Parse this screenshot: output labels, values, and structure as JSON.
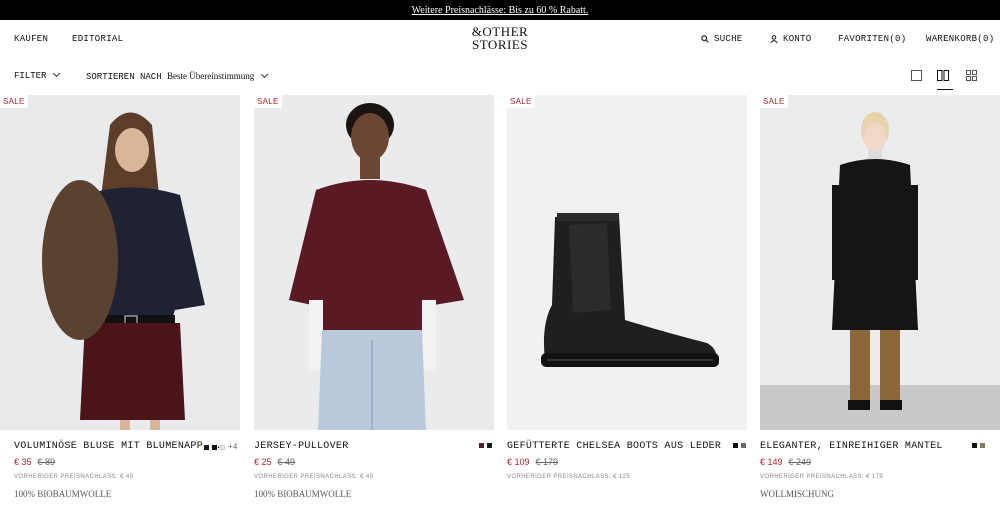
{
  "promo": {
    "text": "Weitere Preisnachlässe: Bis zu 60 % Rabatt."
  },
  "header": {
    "left_nav": [
      "KAUFEN",
      "EDITORIAL"
    ],
    "logo": {
      "line1": "&OTHER",
      "line2": "STORIES"
    },
    "search": "SUCHE",
    "account": "KONTO",
    "favorites": "FAVORITEN(0)",
    "cart": "WARENKORB(0)"
  },
  "toolbar": {
    "filter": "FILTER",
    "sort_label": "SORTIEREN NACH",
    "sort_value": "Beste Übereinstimmung"
  },
  "products": [
    {
      "sale": "SALE",
      "name": "VOLUMINÖSE BLUSE MIT BLUMENAPP...",
      "price": "€ 35",
      "old_price": "€ 89",
      "previous": "VORHERIGER PREISNACHLASS: € 49",
      "material": "100% BIOBAUMWOLLE",
      "swatches": [
        "#1a1a2a",
        "#111111",
        "#e8e8e8"
      ],
      "more": "+4"
    },
    {
      "sale": "SALE",
      "name": "JERSEY-PULLOVER",
      "price": "€ 25",
      "old_price": "€ 49",
      "previous": "VORHERIGER PREISNACHLASS: € 49",
      "material": "100% BIOBAUMWOLLE",
      "swatches": [
        "#5a1a22",
        "#1a1a1a"
      ],
      "more": ""
    },
    {
      "sale": "SALE",
      "name": "GEFÜTTERTE CHELSEA BOOTS AUS LEDER",
      "price": "€ 109",
      "old_price": "€ 179",
      "previous": "VORHERIGER PREISNACHLASS: € 125",
      "material": "",
      "swatches": [
        "#111111",
        "#6b6b6b"
      ],
      "more": ""
    },
    {
      "sale": "SALE",
      "name": "ELEGANTER, EINREIHIGER MANTEL",
      "price": "€ 149",
      "old_price": "€ 249",
      "previous": "VORHERIGER PREISNACHLASS: € 179",
      "material": "WOLLMISCHUNG",
      "swatches": [
        "#111111",
        "#8a7a5a"
      ],
      "more": ""
    }
  ]
}
